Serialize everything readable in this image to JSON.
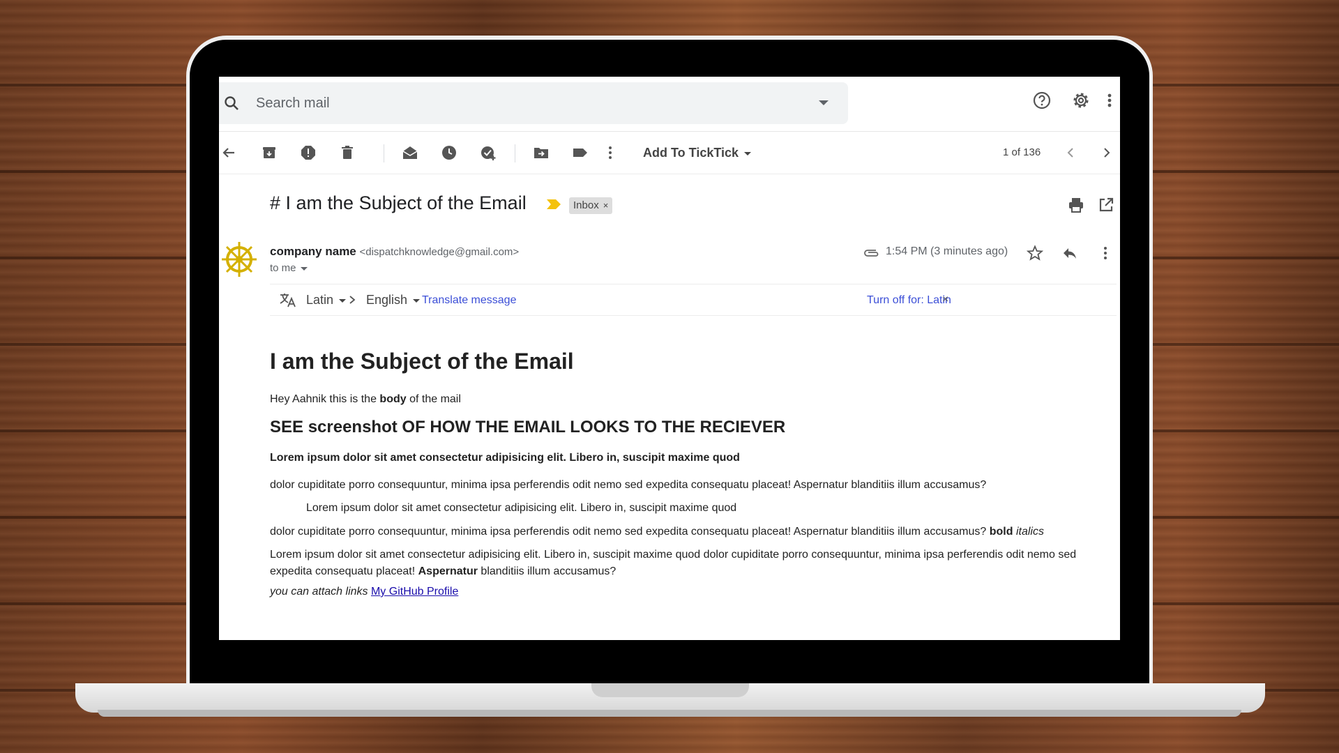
{
  "search": {
    "placeholder": "Search mail"
  },
  "toolbar": {
    "ticktick_label": "Add To TickTick",
    "pager": "1 of 136"
  },
  "email": {
    "subject": "# I am the Subject of the Email",
    "label_chip": "Inbox",
    "label_chip_close": "×",
    "sender_name": "company name",
    "sender_email": "<dispatchknowledge@gmail.com>",
    "to": "to me",
    "time": "1:54 PM (3 minutes ago)"
  },
  "translate": {
    "from": "Latin",
    "to": "English",
    "translate_link": "Translate message",
    "turn_off": "Turn off for: Latin",
    "close": "×"
  },
  "body": {
    "h1": "I am the Subject of the Email",
    "p1_a": "Hey Aahnik this is the ",
    "p1_b": "body",
    "p1_c": " of the mail",
    "h2": "SEE screenshot OF HOW THE EMAIL LOOKS TO THE RECIEVER",
    "bold_line": "Lorem ipsum dolor sit amet consectetur adipisicing elit. Libero in, suscipit maxime quod",
    "p2": "dolor cupiditate porro consequuntur, minima ipsa perferendis odit nemo sed expedita consequatu placeat! Aspernatur blanditiis illum accusamus?",
    "quote": "Lorem ipsum dolor sit amet consectetur adipisicing elit. Libero in, suscipit maxime quod",
    "p3_a": "dolor cupiditate porro consequuntur, minima ipsa perferendis odit nemo sed expedita consequatu placeat! Aspernatur blanditiis illum accusamus? ",
    "p3_bold": "bold",
    "p3_ital": "italics",
    "p4_a": "Lorem ipsum dolor sit amet consectetur adipisicing elit. Libero in, suscipit maxime quod dolor cupiditate porro consequuntur, minima ipsa perferendis odit nemo sed expedita consequatu placeat! ",
    "p4_bold": "Aspernatur",
    "p4_c": " blanditiis illum accusamus?",
    "p5_ital": "you can attach links ",
    "p5_link": "My GitHub Profile"
  },
  "colors": {
    "link": "#3c4fd7",
    "importance_marker": "#f4c20d",
    "avatar": "#d4b000"
  }
}
